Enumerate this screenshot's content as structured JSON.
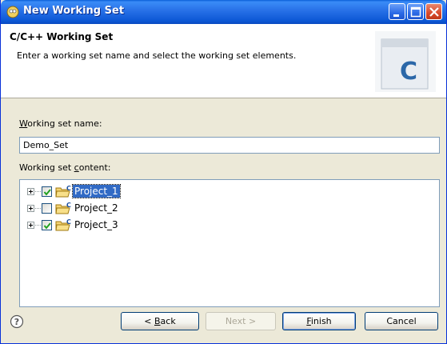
{
  "window": {
    "title": "New Working Set"
  },
  "banner": {
    "title": "C/C++ Working Set",
    "description": "Enter a working set name and select the working set elements.",
    "icon_letter": "C"
  },
  "form": {
    "name_label_prefix": "W",
    "name_label_rest": "orking set name:",
    "name_value": "Demo_Set",
    "content_label_prefix": "Working set ",
    "content_label_mnemonic": "c",
    "content_label_rest": "ontent:"
  },
  "tree": {
    "items": [
      {
        "label": "Project_1",
        "checked": true,
        "selected": true
      },
      {
        "label": "Project_2",
        "checked": false,
        "selected": false
      },
      {
        "label": "Project_3",
        "checked": true,
        "selected": false
      }
    ]
  },
  "buttons": {
    "back_prefix": "< ",
    "back_mnemonic": "B",
    "back_rest": "ack",
    "next": "Next >",
    "finish_mnemonic": "F",
    "finish_rest": "inish",
    "cancel": "Cancel"
  },
  "colors": {
    "title_bar": "#2a73e9",
    "selection": "#316ac5",
    "check": "#21a121"
  },
  "icons": {
    "title": "eclipse-window-icon",
    "banner": "c-file-icon",
    "help": "help-icon",
    "folder": "c-project-folder-icon"
  }
}
